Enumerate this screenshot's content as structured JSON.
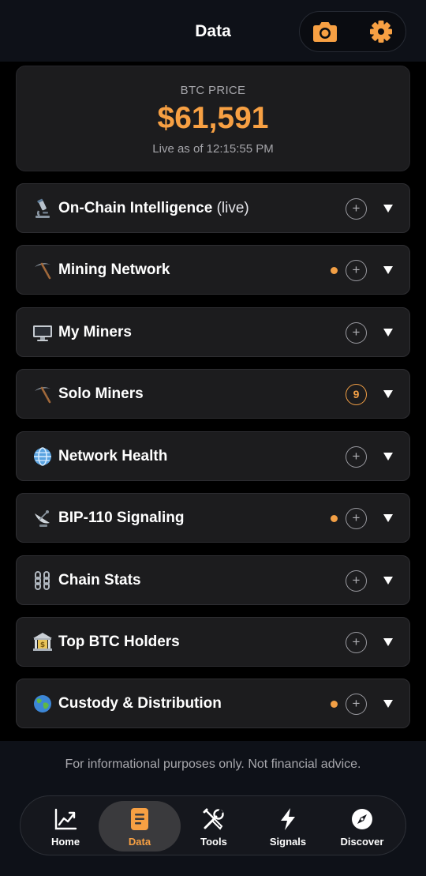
{
  "header": {
    "title": "Data"
  },
  "price": {
    "label": "BTC PRICE",
    "value": "$61,591",
    "updated": "Live as of 12:15:55 PM"
  },
  "sections": [
    {
      "label": "On-Chain Intelligence",
      "suffix": "(live)",
      "emoji": "microscope-emoji"
    },
    {
      "label": "Mining Network",
      "emoji": "pick-emoji",
      "dot": true
    },
    {
      "label": "My Miners",
      "emoji": "desktop-computer-emoji"
    },
    {
      "label": "Solo Miners",
      "emoji": "pick-emoji",
      "badge": "9"
    },
    {
      "label": "Network Health",
      "emoji": "globe-meridians-emoji"
    },
    {
      "label": "BIP-110 Signaling",
      "emoji": "satellite-dish-emoji",
      "dot": true
    },
    {
      "label": "Chain Stats",
      "emoji": "chains-emoji"
    },
    {
      "label": "Top BTC Holders",
      "emoji": "bank-emoji"
    },
    {
      "label": "Custody & Distribution",
      "emoji": "earth-globe-emoji",
      "dot": true
    }
  ],
  "disclaimer": "For informational purposes only. Not financial advice.",
  "tabs": [
    {
      "label": "Home",
      "icon": "chart-trend-icon",
      "active": false
    },
    {
      "label": "Data",
      "icon": "document-icon",
      "active": true
    },
    {
      "label": "Tools",
      "icon": "tools-icon",
      "active": false
    },
    {
      "label": "Signals",
      "icon": "lightning-icon",
      "active": false
    },
    {
      "label": "Discover",
      "icon": "compass-icon",
      "active": false
    }
  ],
  "colors": {
    "accent": "#f7a043",
    "card": "#1c1c1e",
    "background": "#000000",
    "header": "#0e1118"
  }
}
